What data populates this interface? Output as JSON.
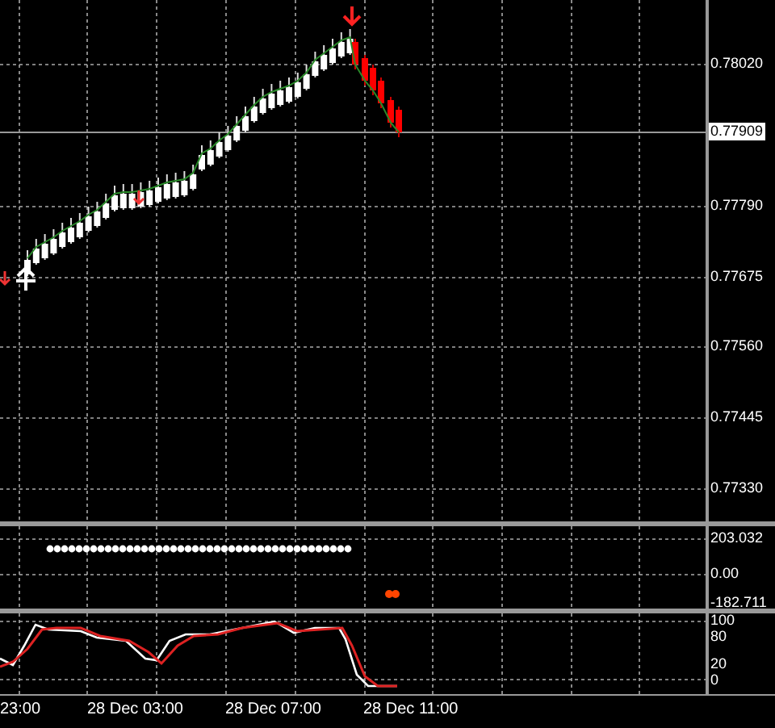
{
  "main_chart": {
    "price_axis": [
      "0.78020",
      "0.77790",
      "0.77675",
      "0.77560",
      "0.77445",
      "0.77330"
    ],
    "current_price": "0.77909"
  },
  "indicator_panel": {
    "axis": [
      "203.032",
      "0.00",
      "-182.711"
    ]
  },
  "oscillator_panel": {
    "axis": [
      "100",
      "80",
      "20",
      "0"
    ]
  },
  "time_axis": [
    "23:00",
    "28 Dec 03:00",
    "28 Dec 07:00",
    "28 Dec 11:00"
  ]
}
